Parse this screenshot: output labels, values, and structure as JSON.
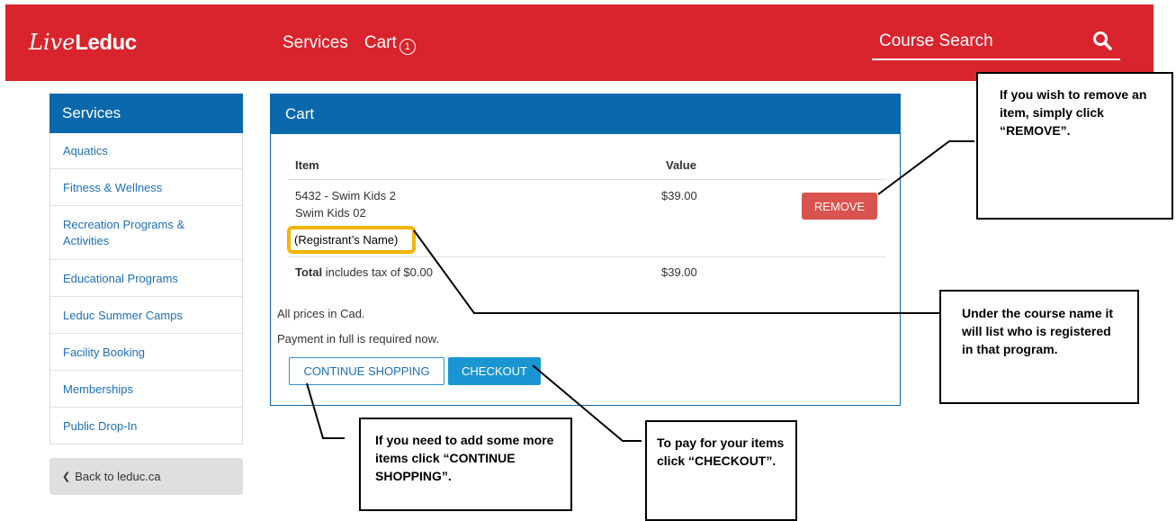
{
  "header": {
    "logo_script": "Live",
    "logo_word": "Leduc",
    "nav": {
      "services": "Services",
      "cart": "Cart",
      "cart_count": "1"
    },
    "search_label": "Course Search",
    "search_icon": "search-icon"
  },
  "sidebar": {
    "title": "Services",
    "items": [
      {
        "label": "Aquatics"
      },
      {
        "label": "Fitness & Wellness"
      },
      {
        "label": "Recreation Programs & Activities"
      },
      {
        "label": "Educational Programs"
      },
      {
        "label": "Leduc Summer Camps"
      },
      {
        "label": "Facility Booking"
      },
      {
        "label": "Memberships"
      },
      {
        "label": "Public Drop-In"
      }
    ],
    "back_label": "Back to leduc.ca"
  },
  "cart": {
    "title": "Cart",
    "col_item": "Item",
    "col_value": "Value",
    "line": {
      "name": "5432 - Swim Kids 2",
      "sub": "Swim Kids 02",
      "registrant": "(Registrant’s Name)",
      "value": "$39.00",
      "remove_label": "REMOVE"
    },
    "total_label": "Total",
    "total_note": "includes tax of $0.00",
    "total_value": "$39.00",
    "note_prices": "All prices in Cad.",
    "note_payment": "Payment in full is required now.",
    "continue_label": "CONTINUE SHOPPING",
    "checkout_label": "CHECKOUT"
  },
  "callouts": {
    "remove": "If you wish to remove an item, simply click “REMOVE”.",
    "registrant": "Under the course name it will list who is registered in that program.",
    "continue": "If you need to add some more items click “CONTINUE SHOPPING”.",
    "checkout": "To pay for your items click “CHECKOUT”."
  },
  "colors": {
    "brand_red": "#d9242d",
    "primary_blue": "#0a68ad",
    "link_blue": "#1d6fb4",
    "remove_red": "#d9534f",
    "checkout_blue": "#1a95d2",
    "highlight_yellow": "#f4b400"
  }
}
